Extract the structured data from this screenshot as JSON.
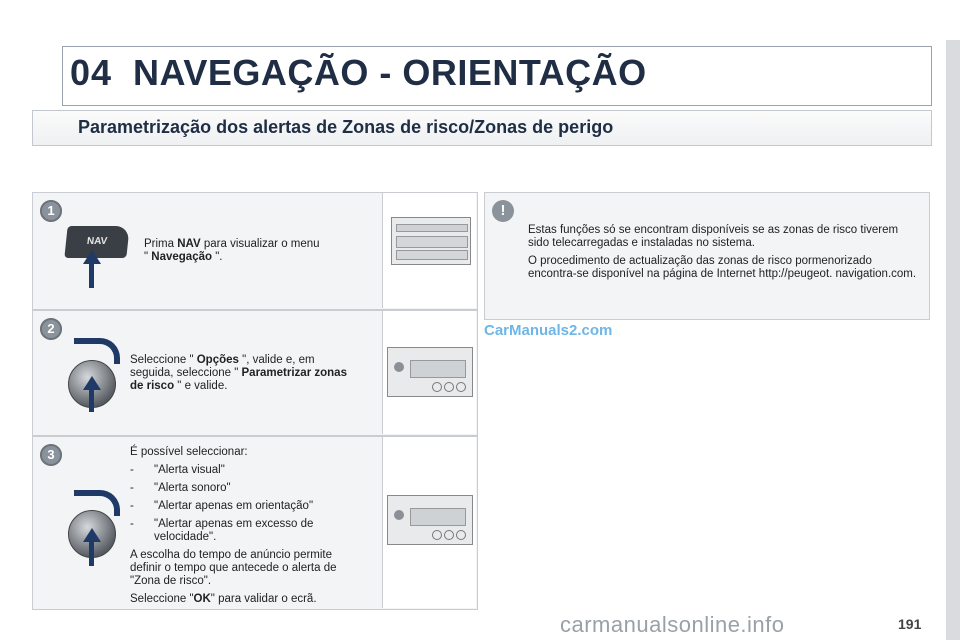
{
  "header": {
    "chapter_number": "04",
    "chapter_title": "NAVEGAÇÃO - ORIENTAÇÃO"
  },
  "section": {
    "title": "Parametrização dos alertas de Zonas de risco/Zonas de perigo"
  },
  "steps": [
    {
      "number": "1",
      "button_label": "NAV",
      "text_pre": "Prima ",
      "text_bold1": "NAV",
      "text_mid": " para visualizar o menu",
      "text_line2_pre": "\" ",
      "text_bold2": "Navegação",
      "text_line2_post": " \"."
    },
    {
      "number": "2",
      "text_pre": "Seleccione \" ",
      "text_bold1": "Opções",
      "text_mid": " \", valide e, em",
      "text_line2": "seguida, seleccione \" ",
      "text_bold2": "Parametrizar zonas",
      "text_bold3": "de risco",
      "text_line3_post": " \" e valide."
    },
    {
      "number": "3",
      "intro": "É possível seleccionar:",
      "options": [
        "\"Alerta visual\"",
        "\"Alerta sonoro\"",
        "\"Alertar apenas em orientação\"",
        "\"Alertar apenas em excesso de velocidade\"."
      ],
      "option_dash": "-",
      "para1": "A escolha do tempo de anúncio permite definir o tempo que antecede o alerta de \"Zona de risco\".",
      "final_pre": "Seleccione \"",
      "final_bold": "OK",
      "final_post": "\" para validar o ecrã."
    }
  ],
  "warning": {
    "icon": "!",
    "para1": "Estas funções só se encontram disponíveis se as zonas de risco tiverem sido telecarregadas e instaladas no sistema.",
    "para2": "O procedimento de actualização das zonas de risco pormenorizado encontra-se disponível na página de Internet http://peugeot. navigation.com."
  },
  "watermarks": {
    "carmanuals": "CarManuals2.com",
    "manualsonline": "carmanualsonline.info"
  },
  "page_number": "191",
  "colors": {
    "title": "#1f2e44",
    "panel": "#f3f4f5",
    "arrow": "#1f3a66",
    "watermark": "#6fb6e6"
  }
}
